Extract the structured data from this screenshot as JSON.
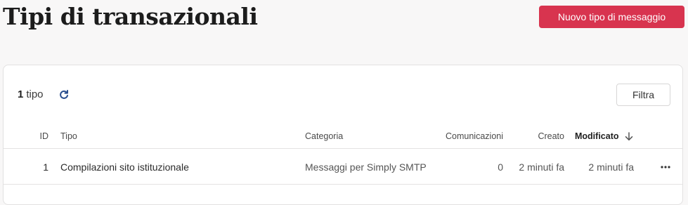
{
  "page": {
    "title": "Tipi di transazionali",
    "new_button_label": "Nuovo tipo di messaggio"
  },
  "toolbar": {
    "count": "1",
    "count_label": "tipo",
    "filter_label": "Filtra"
  },
  "table": {
    "columns": {
      "id": "ID",
      "tipo": "Tipo",
      "categoria": "Categoria",
      "comunicazioni": "Comunicazioni",
      "creato": "Creato",
      "modificato": "Modificato"
    },
    "sorted_column": "modificato",
    "sort_direction": "desc",
    "rows": [
      {
        "id": "1",
        "tipo": "Compilazioni sito istituzionale",
        "categoria": "Messaggi per Simply SMTP",
        "comunicazioni": "0",
        "creato": "2 minuti fa",
        "modificato": "2 minuti fa"
      }
    ]
  },
  "icons": {
    "refresh": "refresh-icon",
    "sort": "arrow-down-icon",
    "row_menu": "more-horizontal-icon"
  },
  "colors": {
    "primary": "#d8344f",
    "accent_icon": "#2a4f8f"
  }
}
